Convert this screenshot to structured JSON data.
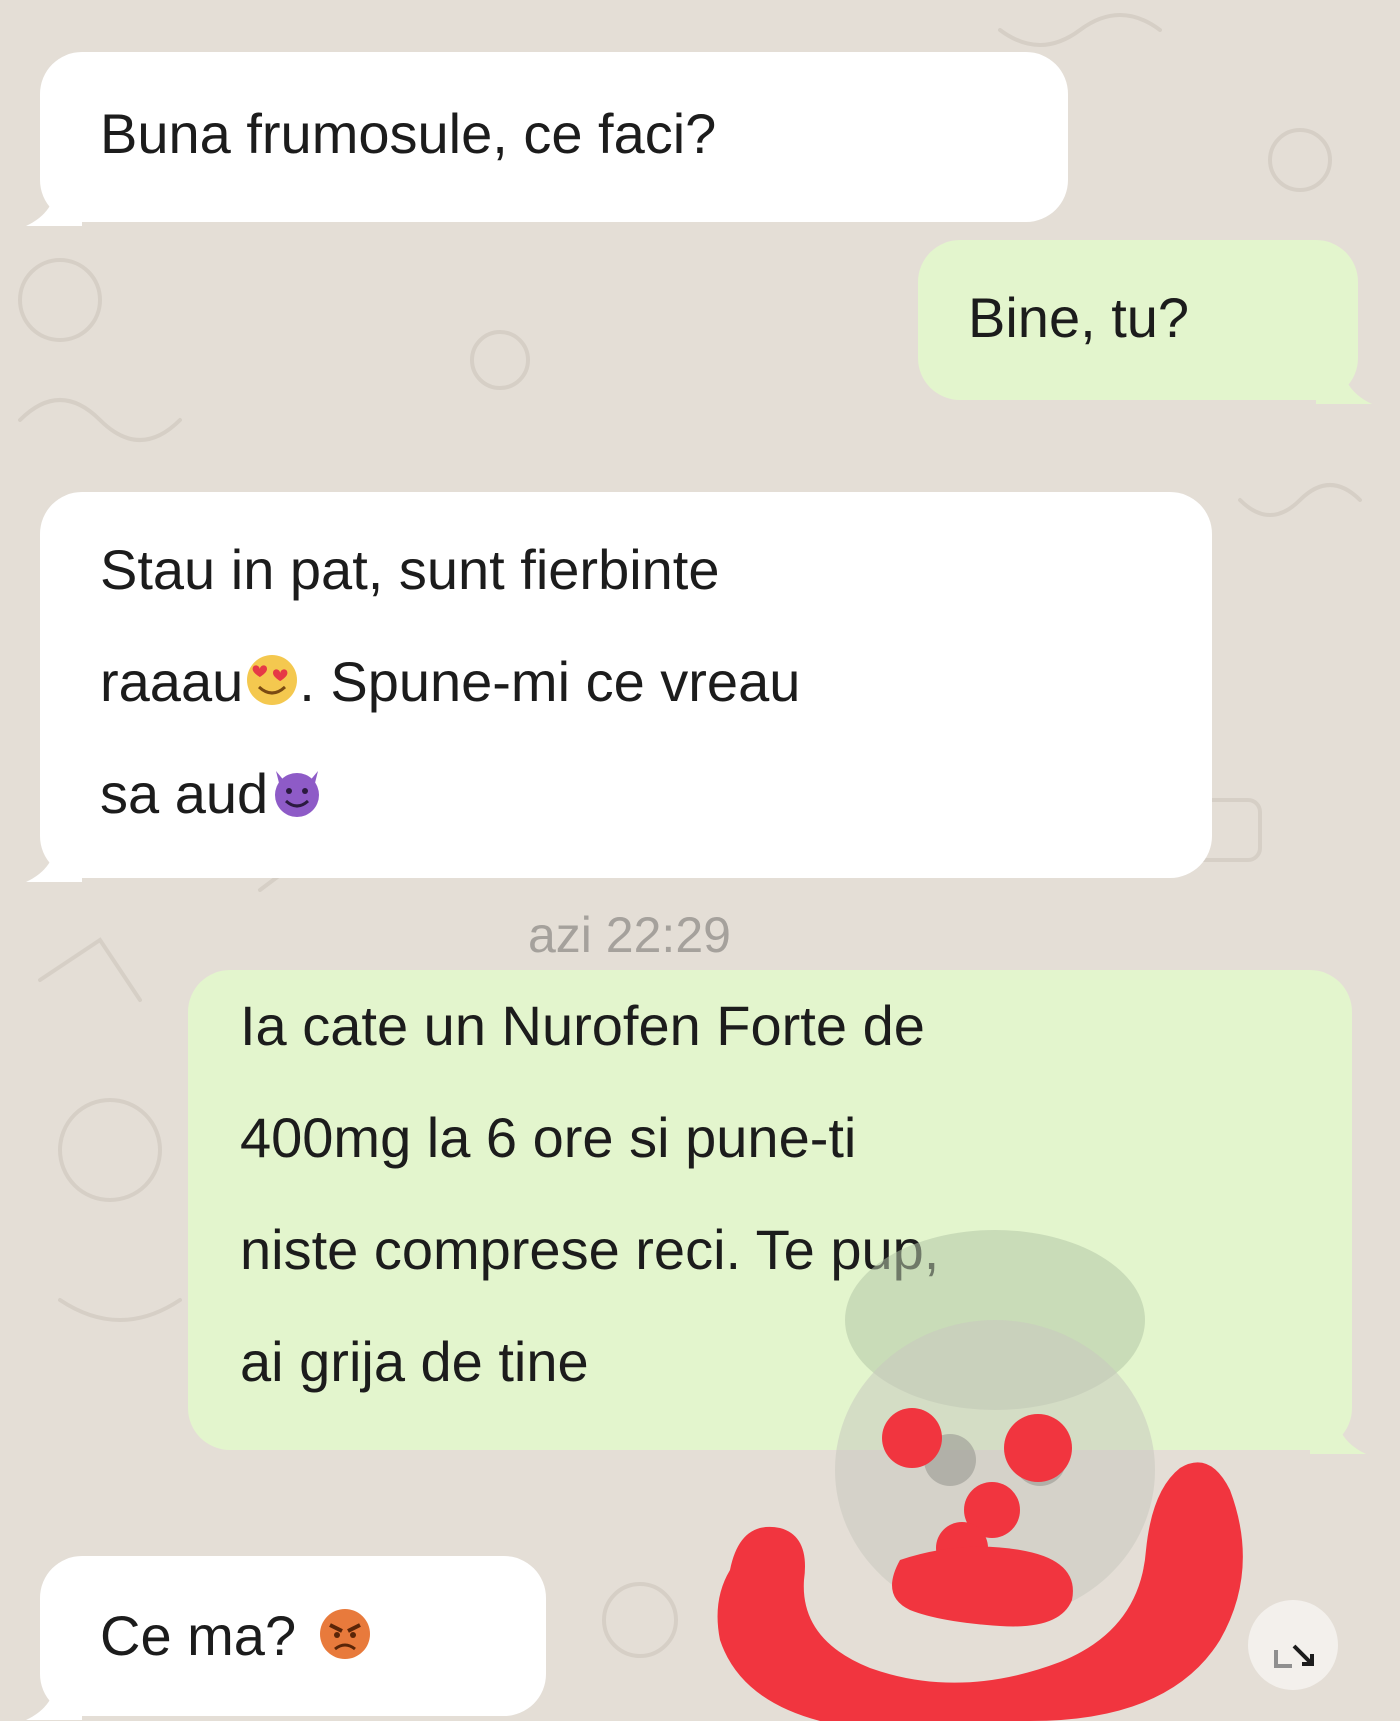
{
  "chat": {
    "messages": [
      {
        "direction": "incoming",
        "lines": [
          "Buna frumosule, ce faci?"
        ]
      },
      {
        "direction": "outgoing",
        "lines": [
          "Bine, tu?"
        ]
      },
      {
        "direction": "incoming",
        "lines": [
          "Stau in pat, sunt fierbinte",
          "raaau",
          ". Spune-mi ce vreau",
          "sa aud"
        ],
        "emojis": [
          "smiling-face-with-heart-eyes",
          "smiling-face-with-horns"
        ]
      },
      {
        "direction": "outgoing",
        "lines": [
          "Ia cate un Nurofen Forte de",
          "400mg la 6 ore si pune-ti",
          "niste comprese reci.  Te pup,",
          "ai grija de tine"
        ]
      },
      {
        "direction": "incoming",
        "lines": [
          "Ce ma?"
        ],
        "emojis": [
          "pouting-face"
        ]
      }
    ],
    "timestamp": "azi 22:29"
  },
  "colors": {
    "incoming_bubble": "#ffffff",
    "outgoing_bubble": "#e3f5cd",
    "background": "#e4ded6",
    "scribble": "#f1353f",
    "timestamp_text": "#a5a19c"
  },
  "icons": [
    "smiling-face-with-heart-eyes",
    "smiling-face-with-horns",
    "pouting-face",
    "expand-icon"
  ]
}
